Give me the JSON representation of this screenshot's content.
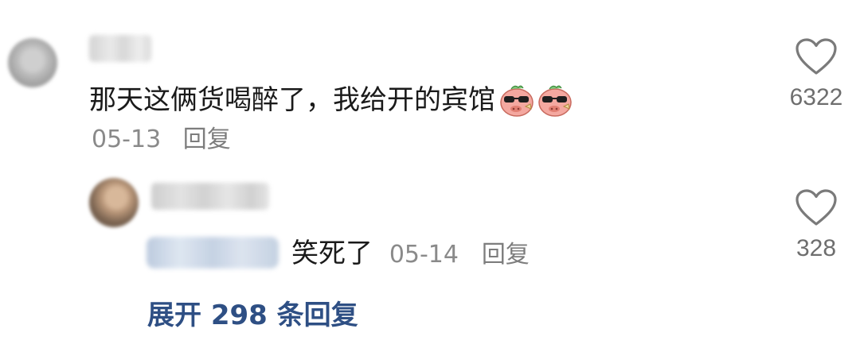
{
  "comment": {
    "text": "那天这俩货喝醉了，我给开的宾馆",
    "emoji_icons": [
      "pig-sunglasses-icon",
      "pig-sunglasses-icon"
    ],
    "date": "05-13",
    "reply_label": "回复",
    "like_count": "6322"
  },
  "reply": {
    "text": "笑死了",
    "date": "05-14",
    "reply_label": "回复",
    "like_count": "328"
  },
  "expand": {
    "label": "展开 298 条回复"
  },
  "colors": {
    "text": "#1a1a1a",
    "muted": "#8a8a8a",
    "link": "#2e4f84",
    "heart_outline": "#7a7a7a"
  }
}
